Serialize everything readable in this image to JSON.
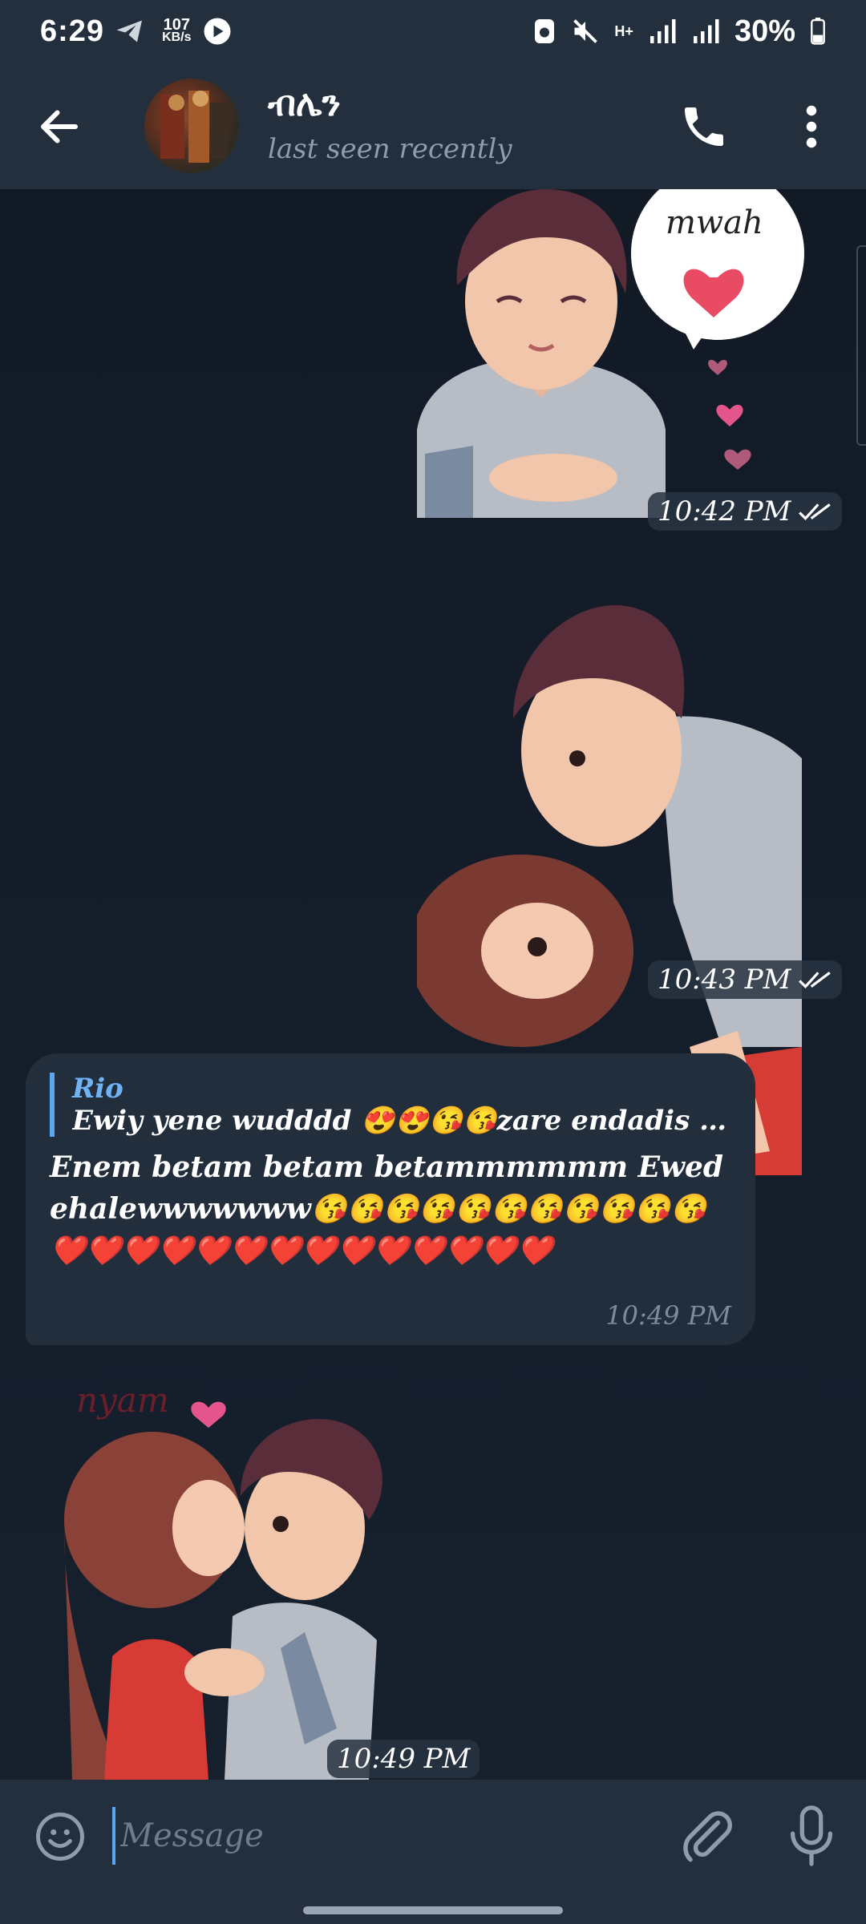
{
  "status_bar": {
    "time": "6:29",
    "net_speed": "107",
    "net_unit": "KB/s",
    "network_type": "H+",
    "battery": "30%"
  },
  "header": {
    "contact_name": "ብሌን",
    "contact_status": "last seen recently"
  },
  "messages": [
    {
      "type": "sticker",
      "sticker_text": "mwah",
      "time": "10:42 PM",
      "read": true
    },
    {
      "type": "sticker",
      "time": "10:43 PM",
      "read": true
    },
    {
      "type": "text",
      "reply_name": "Rio",
      "reply_text": "Ewiy yene wudddd 😍😍😘😘zare endadis yetewele...",
      "text": "Enem betam betam betammmmmm Ewedehalewwwwwww😘😘😘😘😘😘😘😘😘😘😘❤️❤️❤️❤️❤️❤️❤️❤️❤️❤️❤️❤️❤️❤️",
      "time": "10:49 PM"
    },
    {
      "type": "sticker",
      "sticker_text": "nyam",
      "time": "10:49 PM"
    }
  ],
  "composer": {
    "placeholder": "Message"
  },
  "colors": {
    "header_bg": "#242f3d",
    "chat_bg": "#121a26",
    "bubble_bg": "#222e3c",
    "accent": "#5aa7f0"
  }
}
